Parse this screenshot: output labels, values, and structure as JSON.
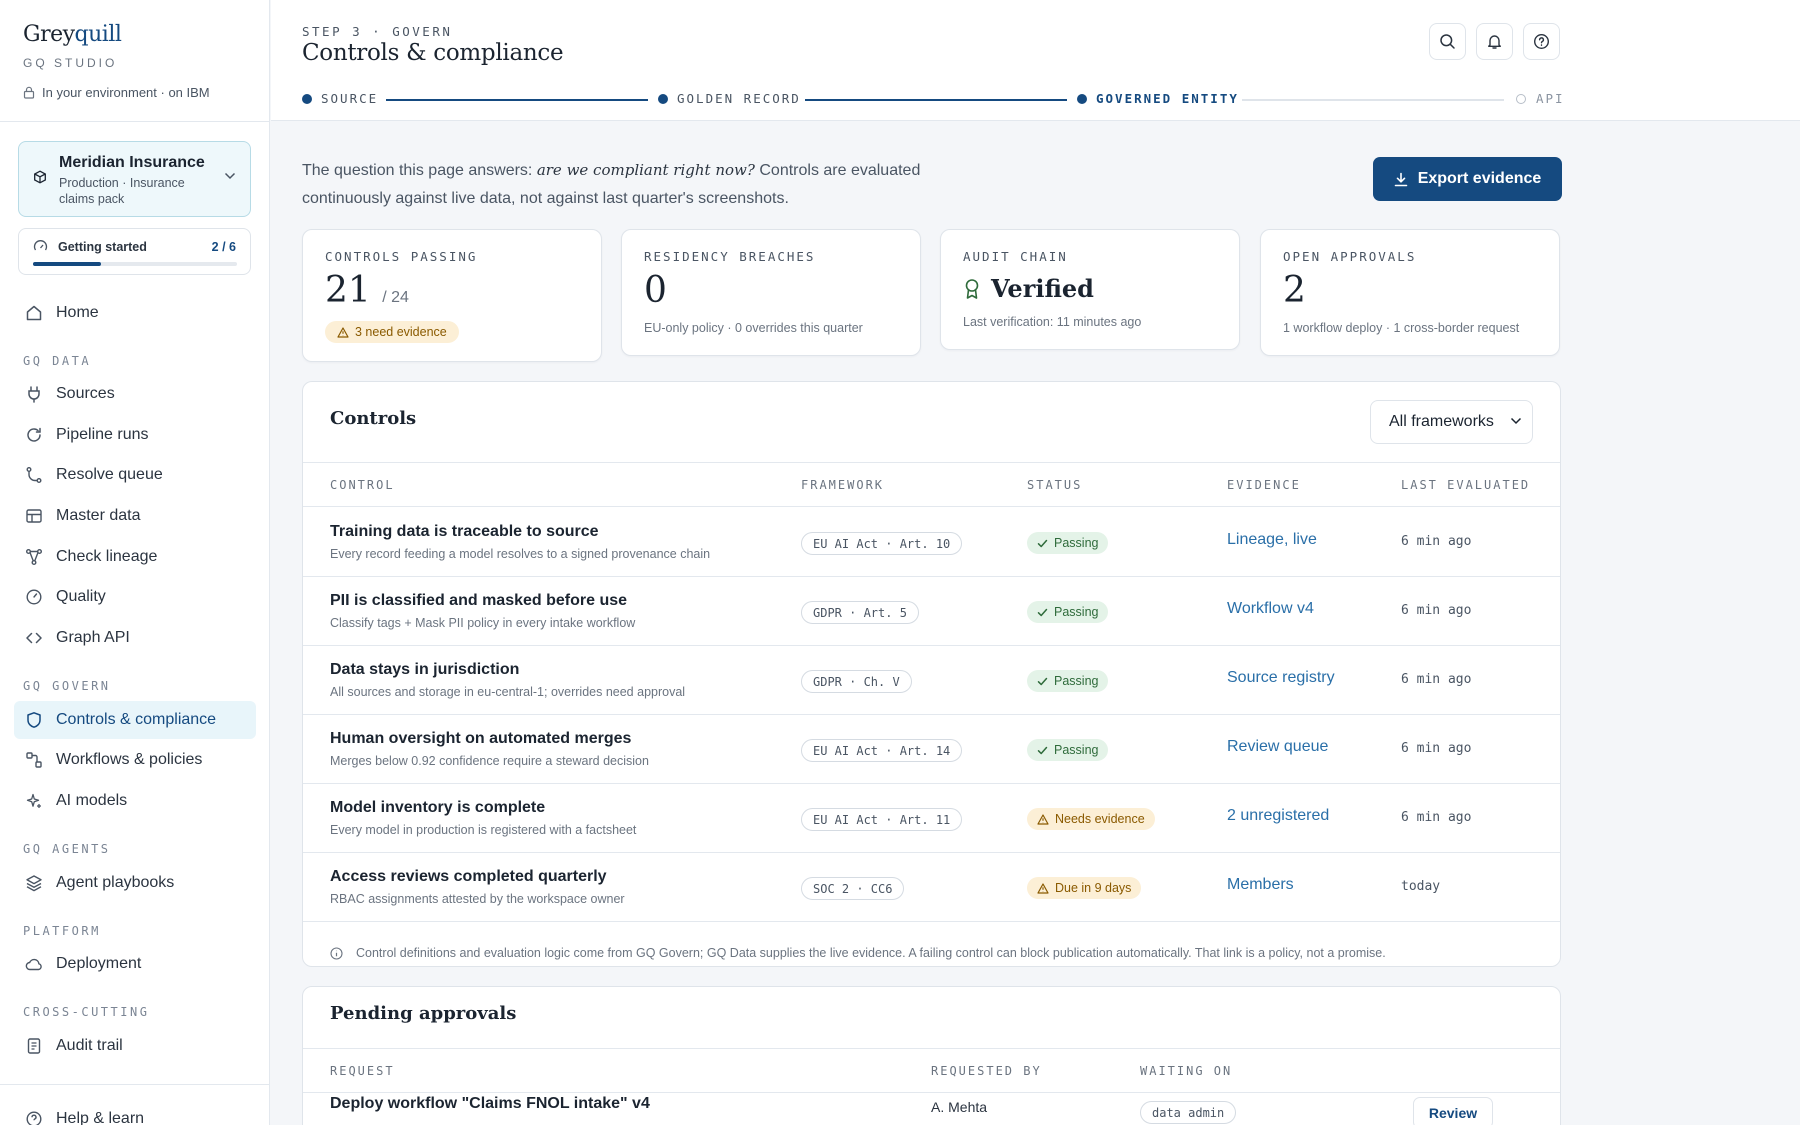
{
  "sidebar": {
    "brand_a": "Grey",
    "brand_b": "quill",
    "studio": "GQ STUDIO",
    "environment": "In your environment · on IBM",
    "org": {
      "name": "Meridian Insurance",
      "desc": "Production · Insurance claims pack"
    },
    "getting_started": {
      "label": "Getting started",
      "count": "2 / 6",
      "progress": 0.333
    },
    "home": "Home",
    "sections": {
      "data": "GQ DATA",
      "govern": "GQ GOVERN",
      "agents": "GQ AGENTS",
      "platform": "PLATFORM",
      "cross": "CROSS-CUTTING"
    },
    "items": {
      "sources": "Sources",
      "pipeline_runs": "Pipeline runs",
      "resolve_queue": "Resolve queue",
      "master_data": "Master data",
      "check_lineage": "Check lineage",
      "quality": "Quality",
      "graph_api": "Graph API",
      "controls": "Controls & compliance",
      "workflows": "Workflows & policies",
      "ai_models": "AI models",
      "agent_playbooks": "Agent playbooks",
      "deployment": "Deployment",
      "audit_trail": "Audit trail",
      "help": "Help & learn"
    }
  },
  "header": {
    "step": "STEP 3 · GOVERN",
    "title": "Controls & compliance",
    "stepper": [
      "SOURCE",
      "GOLDEN RECORD",
      "GOVERNED ENTITY",
      "API"
    ]
  },
  "intro": {
    "lead": "The question this page answers:",
    "question": "are we compliant right now?",
    "rest": "Controls are evaluated continuously against live data, not against last quarter's screenshots."
  },
  "export_label": "Export evidence",
  "kpis": {
    "controls": {
      "label": "CONTROLS PASSING",
      "value": "21",
      "total": "/ 24",
      "badge": "3 need evidence"
    },
    "residency": {
      "label": "RESIDENCY BREACHES",
      "value": "0",
      "sub": "EU-only policy · 0 overrides this quarter"
    },
    "audit": {
      "label": "AUDIT CHAIN",
      "value": "Verified",
      "sub": "Last verification: 11 minutes ago"
    },
    "approvals": {
      "label": "OPEN APPROVALS",
      "value": "2",
      "sub": "1 workflow deploy · 1 cross-border request"
    }
  },
  "controls_panel": {
    "title": "Controls",
    "filter": "All frameworks",
    "headers": {
      "control": "CONTROL",
      "framework": "FRAMEWORK",
      "status": "STATUS",
      "evidence": "EVIDENCE",
      "evaluated": "LAST EVALUATED"
    },
    "rows": [
      {
        "title": "Training data is traceable to source",
        "desc": "Every record feeding a model resolves to a signed provenance chain",
        "framework": "EU AI Act · Art. 10",
        "status": "Passing",
        "evidence": "Lineage, live",
        "evaluated": "6 min ago"
      },
      {
        "title": "PII is classified and masked before use",
        "desc": "Classify tags + Mask PII policy in every intake workflow",
        "framework": "GDPR · Art. 5",
        "status": "Passing",
        "evidence": "Workflow v4",
        "evaluated": "6 min ago"
      },
      {
        "title": "Data stays in jurisdiction",
        "desc": "All sources and storage in eu-central-1; overrides need approval",
        "framework": "GDPR · Ch. V",
        "status": "Passing",
        "evidence": "Source registry",
        "evaluated": "6 min ago"
      },
      {
        "title": "Human oversight on automated merges",
        "desc": "Merges below 0.92 confidence require a steward decision",
        "framework": "EU AI Act · Art. 14",
        "status": "Passing",
        "evidence": "Review queue",
        "evaluated": "6 min ago"
      },
      {
        "title": "Model inventory is complete",
        "desc": "Every model in production is registered with a factsheet",
        "framework": "EU AI Act · Art. 11",
        "status": "Needs evidence",
        "evidence": "2 unregistered",
        "evaluated": "6 min ago"
      },
      {
        "title": "Access reviews completed quarterly",
        "desc": "RBAC assignments attested by the workspace owner",
        "framework": "SOC 2 · CC6",
        "status": "Due in 9 days",
        "evidence": "Members",
        "evaluated": "today"
      }
    ],
    "footnote": "Control definitions and evaluation logic come from GQ Govern; GQ Data supplies the live evidence. A failing control can block publication automatically. That link is a policy, not a promise."
  },
  "approvals_panel": {
    "title": "Pending approvals",
    "headers": {
      "request": "REQUEST",
      "requested_by": "REQUESTED BY",
      "waiting_on": "WAITING ON"
    },
    "rows": [
      {
        "request": "Deploy workflow \"Claims FNOL intake\" v4",
        "requested_by": "A. Mehta",
        "waiting_on": "data admin",
        "action": "Review"
      }
    ]
  },
  "colors": {
    "accent": "#154a80",
    "link": "#2a6fa8",
    "pass_bg": "#e4f3e8",
    "warn_bg": "#fcefd6"
  }
}
